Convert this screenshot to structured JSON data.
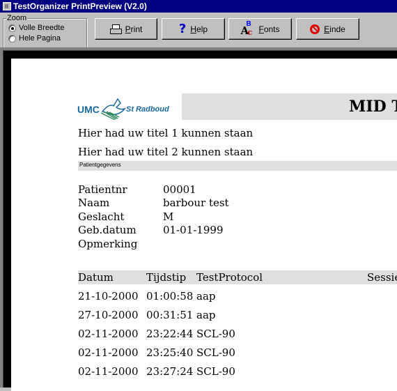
{
  "window": {
    "title": "TestOrganizer PrintPreview  (V2.0)"
  },
  "zoom": {
    "label": "Zoom",
    "options": [
      {
        "label": "Volle Breedte",
        "selected": true
      },
      {
        "label": "Hele Pagina",
        "selected": false
      }
    ]
  },
  "toolbar": {
    "print_label": "Print",
    "help_label": "Help",
    "fonts_label": "Fonts",
    "exit_label": "Einde"
  },
  "report": {
    "logo": {
      "umc": "UMC",
      "radboud": "St Radboud"
    },
    "header_title": "MID Te",
    "title1": "Hier had uw titel 1 kunnen staan",
    "title2": "Hier had uw titel 2 kunnen staan",
    "section_label": "Patientgegevens",
    "patient": [
      {
        "label": "Patientnr",
        "value": "00001"
      },
      {
        "label": "Naam",
        "value": "barbour test"
      },
      {
        "label": "Geslacht",
        "value": "M"
      },
      {
        "label": "Geb.datum",
        "value": "01-01-1999"
      },
      {
        "label": "Opmerking",
        "value": ""
      }
    ],
    "columns": [
      "Datum",
      "Tijdstip",
      "TestProtocol",
      "Sessie"
    ],
    "rows": [
      [
        "21-10-2000",
        "01:00:58",
        "aap"
      ],
      [
        "27-10-2000",
        "00:31:51",
        "aap"
      ],
      [
        "02-11-2000",
        "23:22:44",
        "SCL-90"
      ],
      [
        "02-11-2000",
        "23:25:40",
        "SCL-90"
      ],
      [
        "02-11-2000",
        "23:27:24",
        "SCL-90"
      ]
    ]
  },
  "colors": {
    "titlebar": "#000080",
    "face": "#c0c0c0",
    "band": "#e0e0e0",
    "logo": "#1a6aa0"
  }
}
